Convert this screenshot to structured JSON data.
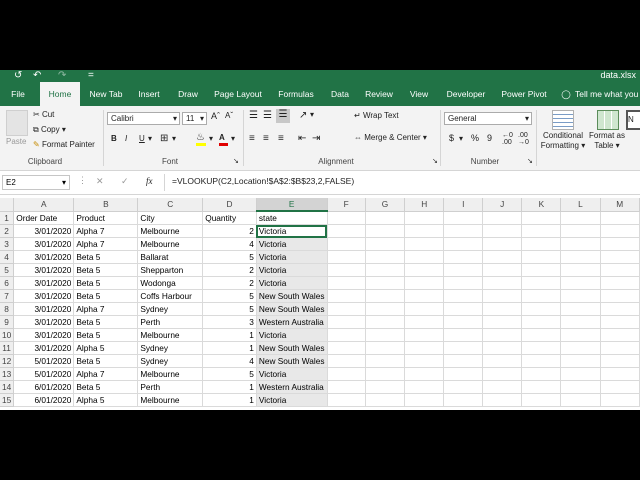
{
  "titlebar": {
    "filename": "data.xlsx"
  },
  "menu": {
    "tabs": [
      "File",
      "Home",
      "New Tab",
      "Insert",
      "Draw",
      "Page Layout",
      "Formulas",
      "Data",
      "Review",
      "View",
      "Developer",
      "Power Pivot"
    ],
    "tell_me": "Tell me what you w"
  },
  "ribbon": {
    "paste": "Paste",
    "cut": "Cut",
    "copy": "Copy",
    "format_painter": "Format Painter",
    "clipboard": "Clipboard",
    "font_name": "Calibri",
    "font_size": "11",
    "font_group": "Font",
    "wrap_text": "Wrap Text",
    "merge_center": "Merge & Center",
    "alignment": "Alignment",
    "number_format": "General",
    "number": "Number",
    "conditional_formatting": "Conditional Formatting",
    "format_as_table": "Format as Table",
    "currency_symbol": "$",
    "percent_symbol": "%",
    "comma_symbol": "9"
  },
  "formula_bar": {
    "name_box": "E2",
    "fx": "fx",
    "formula": "=VLOOKUP(C2,Location!$A$2:$B$23,2,FALSE)"
  },
  "sheet": {
    "columns": [
      "A",
      "B",
      "C",
      "D",
      "E",
      "F",
      "G",
      "H",
      "I",
      "J",
      "K",
      "L",
      "M"
    ],
    "selected_column": "E",
    "headers": [
      "Order Date",
      "Product",
      "City",
      "Quantity",
      "state"
    ],
    "rows": [
      [
        "3/01/2020",
        "Alpha 7",
        "Melbourne",
        "2",
        "Victoria"
      ],
      [
        "3/01/2020",
        "Alpha 7",
        "Melbourne",
        "4",
        "Victoria"
      ],
      [
        "3/01/2020",
        "Beta 5",
        "Ballarat",
        "5",
        "Victoria"
      ],
      [
        "3/01/2020",
        "Beta 5",
        "Shepparton",
        "2",
        "Victoria"
      ],
      [
        "3/01/2020",
        "Beta 5",
        "Wodonga",
        "2",
        "Victoria"
      ],
      [
        "3/01/2020",
        "Beta 5",
        "Coffs Harbour",
        "5",
        "New South Wales"
      ],
      [
        "3/01/2020",
        "Alpha 7",
        "Sydney",
        "5",
        "New South Wales"
      ],
      [
        "3/01/2020",
        "Beta 5",
        "Perth",
        "3",
        "Western Australia"
      ],
      [
        "3/01/2020",
        "Beta 5",
        "Melbourne",
        "1",
        "Victoria"
      ],
      [
        "3/01/2020",
        "Alpha 5",
        "Sydney",
        "1",
        "New South Wales"
      ],
      [
        "5/01/2020",
        "Beta 5",
        "Sydney",
        "4",
        "New South Wales"
      ],
      [
        "5/01/2020",
        "Alpha 7",
        "Melbourne",
        "5",
        "Victoria"
      ],
      [
        "6/01/2020",
        "Beta 5",
        "Perth",
        "1",
        "Western Australia"
      ],
      [
        "6/01/2020",
        "Alpha 5",
        "Melbourne",
        "1",
        "Victoria"
      ]
    ]
  }
}
